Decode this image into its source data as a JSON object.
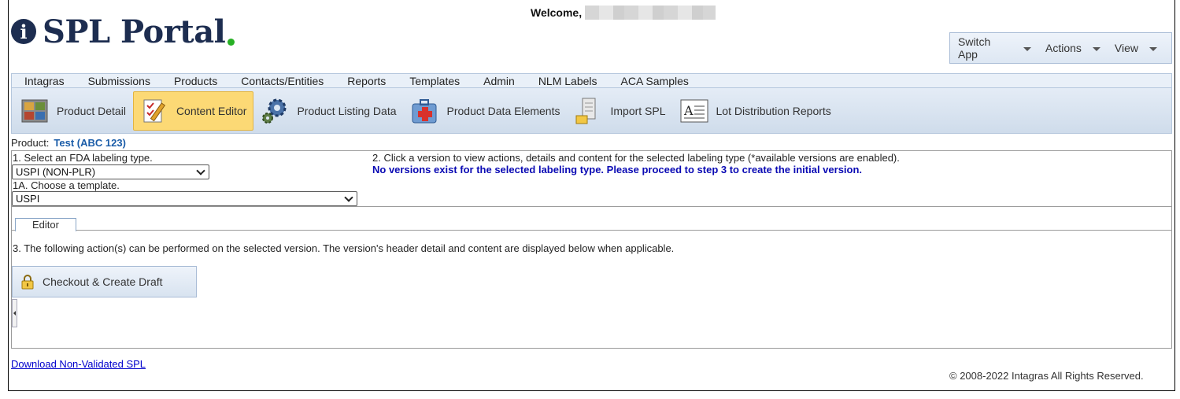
{
  "app": {
    "logo_text": "SPL Portal",
    "logo_badge": "i",
    "welcome_label": "Welcome,"
  },
  "app_menu": {
    "items": [
      {
        "label": "Switch App"
      },
      {
        "label": "Actions"
      },
      {
        "label": "View"
      }
    ]
  },
  "nav": {
    "items": [
      {
        "label": "Intagras"
      },
      {
        "label": "Submissions"
      },
      {
        "label": "Products"
      },
      {
        "label": "Contacts/Entities"
      },
      {
        "label": "Reports"
      },
      {
        "label": "Templates"
      },
      {
        "label": "Admin"
      },
      {
        "label": "NLM Labels"
      },
      {
        "label": "ACA Samples"
      }
    ]
  },
  "toolbar": {
    "items": [
      {
        "label": "Product Detail",
        "icon": "product-grid-icon"
      },
      {
        "label": "Content Editor",
        "icon": "pencil-checklist-icon",
        "active": true
      },
      {
        "label": "Product Listing Data",
        "icon": "gears-icon"
      },
      {
        "label": "Product Data Elements",
        "icon": "first-aid-kit-icon"
      },
      {
        "label": "Import SPL",
        "icon": "server-import-icon"
      },
      {
        "label": "Lot Distribution Reports",
        "icon": "document-a-icon"
      }
    ]
  },
  "product": {
    "label": "Product:",
    "value": "Test (ABC 123)"
  },
  "step1": {
    "label": "1. Select an FDA labeling type.",
    "selected": "USPI (NON-PLR)"
  },
  "step1a": {
    "label": "1A. Choose a template.",
    "selected": "USPI"
  },
  "step2": {
    "label": "2. Click a version to view actions, details and content for the selected labeling type (*available versions are enabled).",
    "notice": "No versions exist for the selected labeling type. Please proceed to step 3 to create the initial version."
  },
  "editor_tab": {
    "label": "Editor"
  },
  "step3": {
    "label": "3. The following action(s) can be performed on the selected version. The version's header detail and content are displayed below when applicable.",
    "checkout_label": "Checkout & Create Draft"
  },
  "footer": {
    "download_link": "Download Non-Validated SPL",
    "copyright": "© 2008-2022 Intagras All Rights Reserved."
  },
  "colors": {
    "brand_navy": "#1d2d50",
    "brand_green": "#27b024",
    "active_tool": "#fcd975",
    "product_link": "#1a5ca8",
    "notice_text": "#0a0ab4"
  }
}
